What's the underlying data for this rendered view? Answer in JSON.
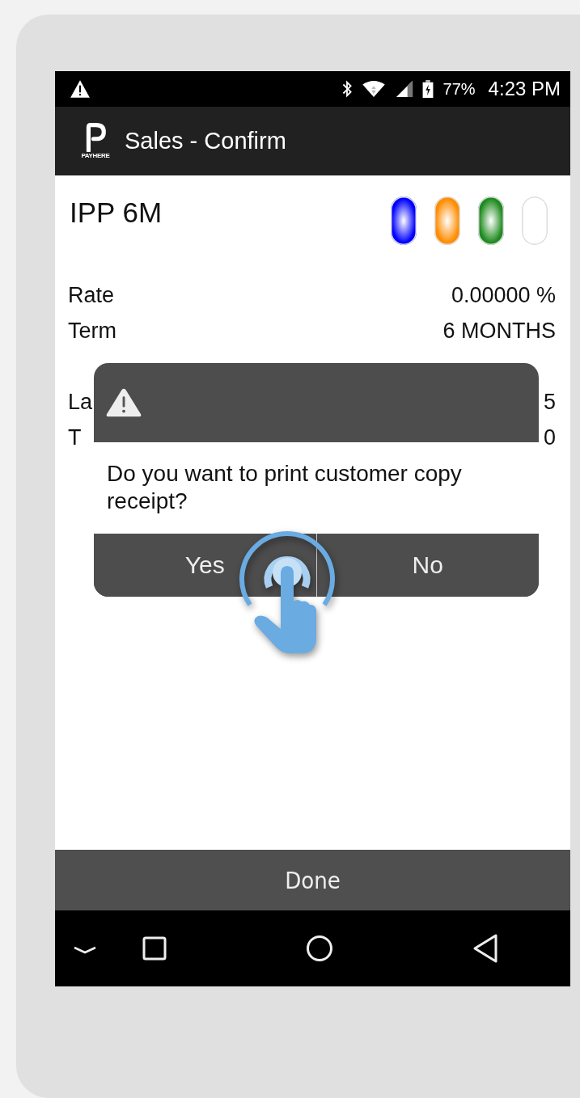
{
  "status_bar": {
    "battery": "77%",
    "time": "4:23 PM"
  },
  "app_bar": {
    "logo_text": "PAYHERE",
    "title": "Sales - Confirm"
  },
  "plan": {
    "name": "IPP 6M",
    "lights": [
      {
        "color": "#0000ff"
      },
      {
        "color": "#ff8c00"
      },
      {
        "color": "#1e8a1e"
      },
      {
        "color": "#ffffff"
      }
    ]
  },
  "details": [
    {
      "label": "Rate",
      "value": "0.00000 %"
    },
    {
      "label": "Term",
      "value": "6 MONTHS"
    },
    {
      "label": "La",
      "value": "5"
    },
    {
      "label": "T",
      "value": "0"
    }
  ],
  "dialog": {
    "message": "Do you want to print customer copy receipt?",
    "buttons": [
      "Yes",
      "No"
    ]
  },
  "done_button": "Done"
}
